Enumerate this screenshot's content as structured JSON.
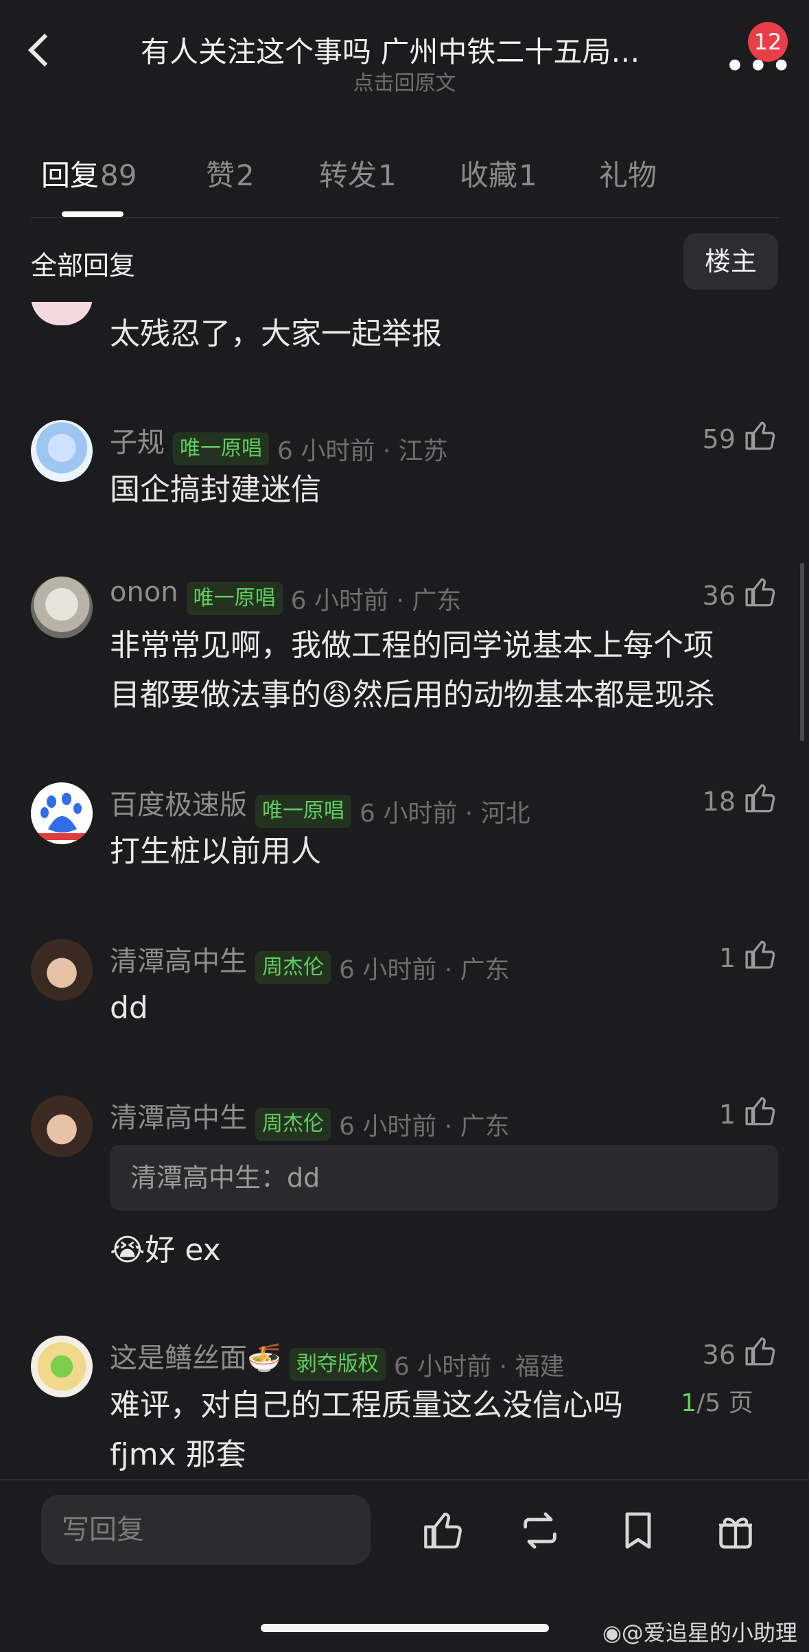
{
  "header": {
    "title": "有人关注这个事吗 广州中铁二十五局…",
    "subtitle": "点击回原文",
    "more": "•••",
    "badge": "12"
  },
  "tabs": [
    {
      "label": "回复",
      "count": "89"
    },
    {
      "label": "赞",
      "count": "2"
    },
    {
      "label": "转发",
      "count": "1"
    },
    {
      "label": "收藏",
      "count": "1"
    },
    {
      "label": "礼物",
      "count": ""
    }
  ],
  "section": {
    "all_replies": "全部回复",
    "owner_only": "楼主"
  },
  "partial_comment": {
    "text": "太残忍了，大家一起举报"
  },
  "comments": [
    {
      "name": "子规",
      "tag": "唯一原唱",
      "meta": "6 小时前 · 江苏",
      "likes": "59",
      "lines": [
        "国企搞封建迷信"
      ]
    },
    {
      "name": "onon",
      "tag": "唯一原唱",
      "meta": "6 小时前 · 广东",
      "likes": "36",
      "lines": [
        "非常常见啊，我做工程的同学说基本上每个项",
        "目都要做法事的😩然后用的动物基本都是现杀"
      ]
    },
    {
      "name": "百度极速版",
      "tag": "唯一原唱",
      "meta": "6 小时前 · 河北",
      "likes": "18",
      "lines": [
        "打生桩以前用人"
      ]
    },
    {
      "name": "清潭高中生",
      "tag": "周杰伦",
      "meta": "6 小时前 · 广东",
      "likes": "1",
      "lines": [
        "dd"
      ]
    },
    {
      "name": "清潭高中生",
      "tag": "周杰伦",
      "meta": "6 小时前 · 广东",
      "likes": "1",
      "quote": "清潭高中生：dd",
      "lines": [
        "😭好 ex"
      ]
    },
    {
      "name": "这是鳝丝面🍜",
      "tag": "剥夺版权",
      "meta": "6 小时前 · 福建",
      "likes": "36",
      "lines": [
        "难评，对自己的工程质量这么没信心吗",
        "fjmx 那套"
      ]
    }
  ],
  "pager": {
    "current": "1",
    "total": "/5 页"
  },
  "bottom": {
    "reply_placeholder": "写回复"
  },
  "watermark": "@爱追星的小助理",
  "colors": {
    "background": "#1c1c1e",
    "tag_green": "#5fce5f",
    "badge_red": "#ea3e46"
  }
}
